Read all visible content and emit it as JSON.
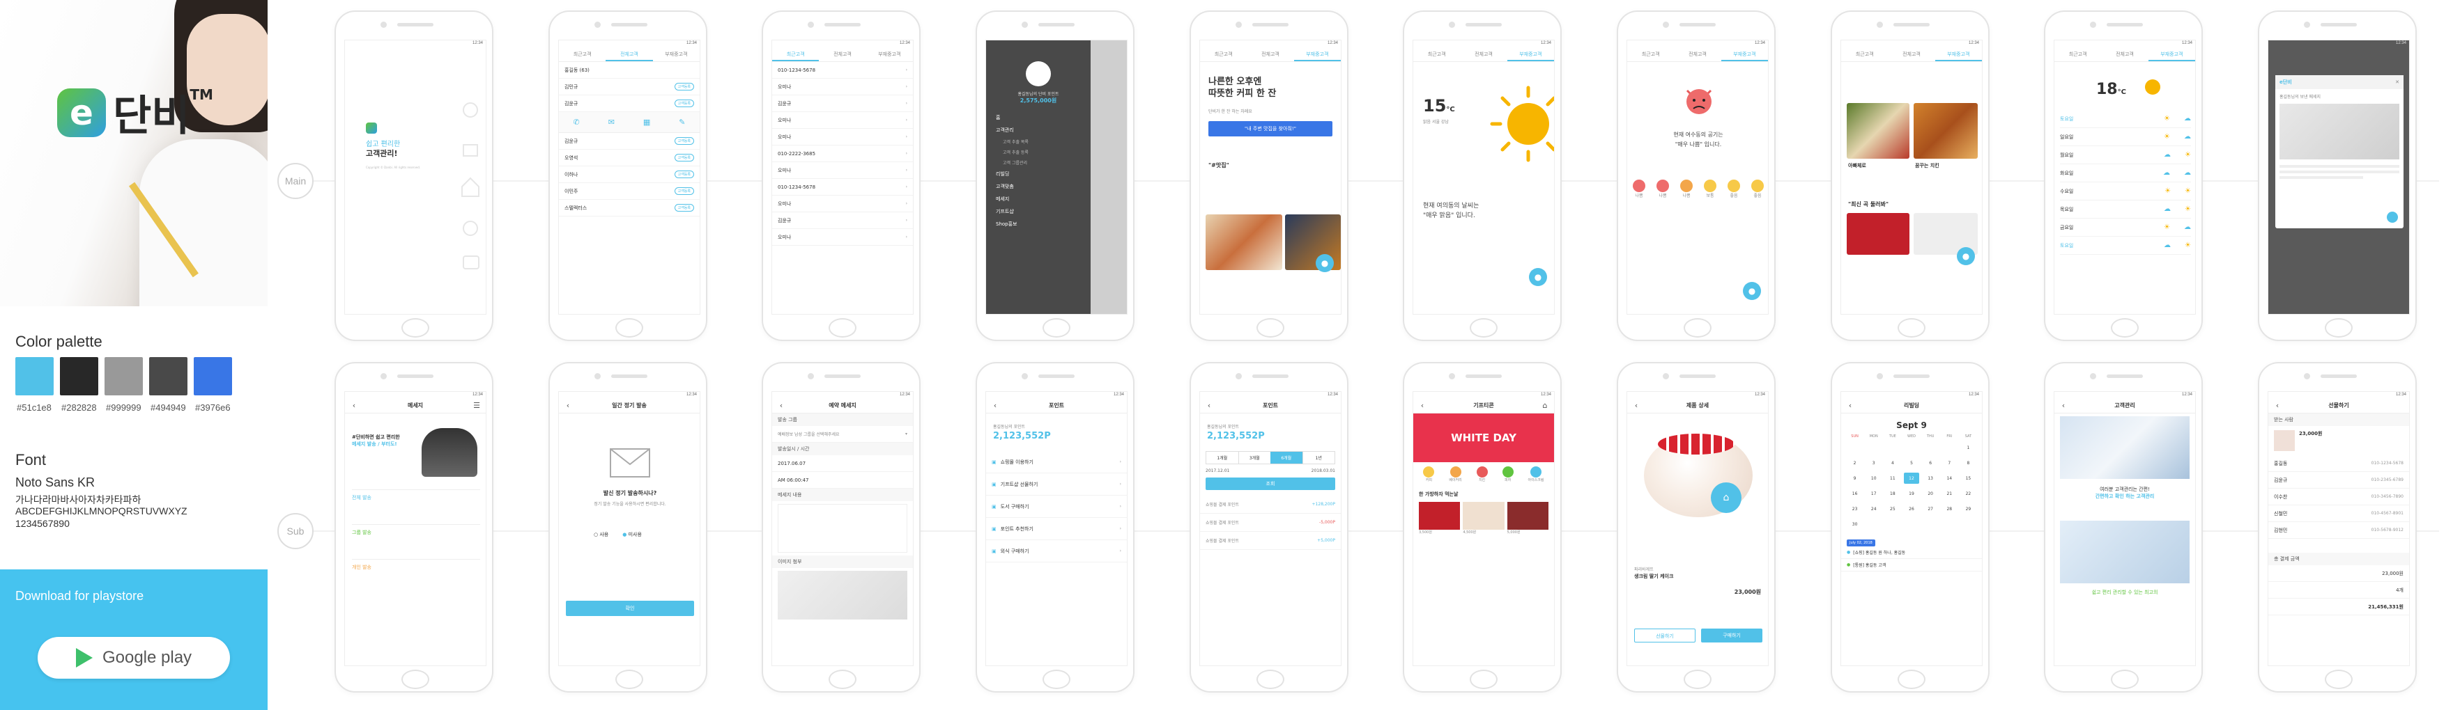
{
  "brand": {
    "logo_letter": "e",
    "name": "단비",
    "tm": "TM"
  },
  "palette": {
    "title": "Color palette",
    "colors": [
      "#51c1e8",
      "#282828",
      "#999999",
      "#494949",
      "#3976e6"
    ],
    "labels": [
      "#51c1e8",
      "#282828",
      "#999999",
      "#494949",
      "#3976e6"
    ]
  },
  "font": {
    "title": "Font",
    "name": "Noto Sans KR",
    "sample_korean": "가나다라마바사아자차카타파하",
    "sample_latin": "ABCDEFGHIJKLMNOPQRSTUVWXYZ",
    "sample_digits": "1234567890"
  },
  "download": {
    "label": "Download for playstore",
    "button": "Google play"
  },
  "guides": {
    "main": "Main",
    "sub": "Sub"
  },
  "screens": {
    "splash": {
      "t1": "쉽고 편리한",
      "t2": "고객관리!",
      "copy": "Copyright © Danbi. All rights reserved."
    },
    "list": {
      "tabs": [
        "최근고객",
        "전체고객",
        "부재중고객"
      ],
      "rows": [
        "홍길동 (63)",
        "김민규",
        "김윤규",
        "김윤규",
        "오영석",
        "이하나",
        "이민주",
        "스텔렉터스"
      ],
      "badge": "고객등록"
    },
    "calls": {
      "tabs": [
        "최근고객",
        "전체고객",
        "부재중고객"
      ],
      "numbers": [
        "010-1234-5678",
        "오미나",
        "김윤규",
        "오미나",
        "오미나",
        "010-2222-3685",
        "오미나",
        "010-1234-5678",
        "오미나",
        "김윤규",
        "오미나"
      ]
    },
    "drawer": {
      "user": "홍길동님의 단비 포인트",
      "points": "2,575,000원",
      "items": [
        "홈",
        "고객관리",
        "고객 추출 목록",
        "고객 추출 등록",
        "고객 그룹관리",
        "리빌딩",
        "고객맞춤",
        "메세지",
        "기프트샵",
        "Shop홍보"
      ]
    },
    "coffee": {
      "tabs": [
        "최근고객",
        "전체고객",
        "부재중고객"
      ],
      "headline1": "나른한 오후엔",
      "headline2": "따뜻한 커피 한 잔",
      "prompt": "단비가 한 잔 하는 차례요",
      "button": "\"내 주변 맛집을 찾아줘!\"",
      "tag": "\"#맛집\""
    },
    "weather1": {
      "temp": "15",
      "unit": "°C",
      "loc": "맑음 서울 강남",
      "line1": "현재 여의동의 날씨는",
      "line2": "\"매우 맑음\" 입니다."
    },
    "mood": {
      "line1": "현재 여수동의 공기는",
      "line2": "\"매우 나쁨\" 입니다.",
      "faces": [
        "나쁨",
        "나쁨",
        "나쁨",
        "보통",
        "좋음",
        "좋음"
      ]
    },
    "feed": {
      "tabs": [
        "최근고객",
        "전체고객",
        "부재중고객"
      ],
      "caption1": "아빠체로",
      "caption2": "꿈꾸는 치킨",
      "section": "\"최신 곡 둘러봐\""
    },
    "weather2": {
      "temp": "18",
      "unit": "°C",
      "days": [
        "토요일",
        "일요일",
        "월요일",
        "화요일",
        "수요일",
        "목요일",
        "금요일",
        "토요일"
      ]
    },
    "popup": {
      "title": "e단비",
      "text": "홍길동님의 보낸 메세지"
    },
    "message": {
      "title": "메세지",
      "tagline1": "#단비하면 쉽고 편리한",
      "tagline2": "메세지 발송 / 부터도!",
      "sections": [
        "전체 발송",
        "그룹 발송",
        "개인 발송"
      ]
    },
    "mail": {
      "title": "일간 정기 발송",
      "q": "발신 정기 발송하시나?",
      "desc": "정기 발송 기능을 사용하시면 편리합니다.",
      "opt1": "사용",
      "opt2": "미사용",
      "ok": "확인"
    },
    "compose": {
      "title": "예약 메세지",
      "fields": [
        "발송 그룹",
        "발송일시 / 시간",
        "메세지 내용",
        "이미지 첨부"
      ],
      "group": "예배정보 남성 그룹을 선택해주세요",
      "d1": "2017.06.07",
      "d2": "AM 06:00:47"
    },
    "points": {
      "title": "포인트",
      "user": "홍길동님의 포인트",
      "value": "2,123,552P",
      "items": [
        "쇼핑몰 이용하기",
        "기프트샵 선물하기",
        "도서 구매하기",
        "포인트 추천하기",
        "외식 구매하기"
      ]
    },
    "points2": {
      "title": "포인트",
      "user": "홍길동님의 포인트",
      "value": "2,123,552P",
      "filters": [
        "1개월",
        "3개월",
        "6개월",
        "1년"
      ],
      "range1": "2017.12.01",
      "range2": "2018.03.01",
      "search": "조회",
      "rows": [
        "쇼핑몰 결제 포인트",
        "쇼핑몰 결제 포인트",
        "쇼핑몰 결제 포인트"
      ],
      "amounts": [
        "+128,200P",
        "-5,000P",
        "+5,000P"
      ]
    },
    "gift": {
      "title": "기프티콘",
      "banner": "WHITE DAY",
      "cats": [
        "커피",
        "베이커리",
        "치킨",
        "피자",
        "아이스크림"
      ],
      "sec": "한 가방하자 먹는날",
      "prices": [
        "3,500원",
        "4,500원",
        "5,000원"
      ]
    },
    "product": {
      "title": "제품 상세",
      "brand": "파리바게뜨",
      "name": "생크림 딸기 케이크",
      "price": "23,000원",
      "b1": "선물하기",
      "b2": "구매하기"
    },
    "calendar": {
      "title": "리빌딩",
      "month": "Sept 9",
      "weekdays": [
        "SUN",
        "MON",
        "TUE",
        "WED",
        "THU",
        "FRI",
        "SAT"
      ],
      "days": [
        "",
        "",
        "",
        "",
        "",
        "",
        "1",
        "2",
        "3",
        "4",
        "5",
        "6",
        "7",
        "8",
        "9",
        "10",
        "11",
        "12",
        "13",
        "14",
        "15",
        "16",
        "17",
        "18",
        "19",
        "20",
        "21",
        "22",
        "23",
        "24",
        "25",
        "26",
        "27",
        "28",
        "29",
        "30"
      ],
      "selected": "12",
      "date_tag": "July 02, 2018",
      "ev1": "[쇼핑] 홍길동 원 하나, 홍길동",
      "ev2": "[통원] 홍길동 고객"
    },
    "crm": {
      "title": "고객관리",
      "line1": "여러분 고객관리는 간편!",
      "line2": "간편하고 확인 하는 고객관리",
      "bottom": "쉽고 편리 관리할 수 있는 최고의"
    },
    "order": {
      "title": "선물하기",
      "recipient": "받는 사람",
      "rows": [
        "홍길동",
        "김윤규",
        "이수찬",
        "신철민",
        "김현민"
      ],
      "phones": [
        "010-1234-5678",
        "010-2345-6789",
        "010-3456-7890",
        "010-4567-8901",
        "010-5678-9012"
      ],
      "total": "총 결제 금액",
      "totals": [
        "23,000원",
        "4개",
        "21,456,331원"
      ]
    }
  }
}
